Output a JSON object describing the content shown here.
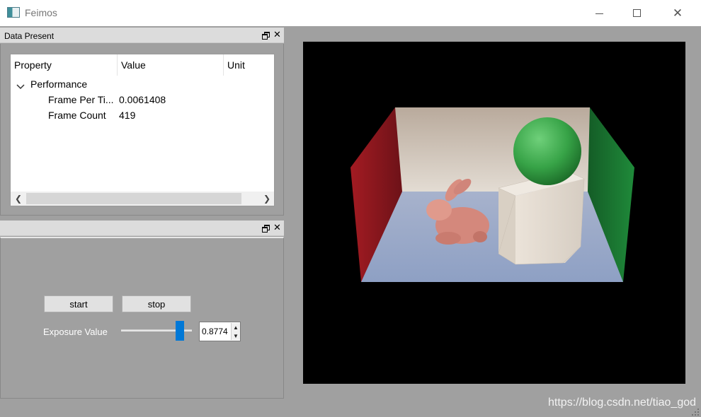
{
  "window": {
    "title": "Feimos",
    "icon": "app-window-icon"
  },
  "dock_data": {
    "title": "Data Present",
    "tree": {
      "columns": [
        "Property",
        "Value",
        "Unit"
      ],
      "group": "Performance",
      "rows": [
        {
          "property": "Frame Per Ti...",
          "value": "0.0061408",
          "unit": ""
        },
        {
          "property": "Frame Count",
          "value": "419",
          "unit": ""
        }
      ]
    }
  },
  "dock_control": {
    "title": "",
    "start_label": "start",
    "stop_label": "stop",
    "exposure_label": "Exposure Value",
    "exposure_value": "0.8774",
    "slider_level": 0.88
  },
  "watermark": "https://blog.csdn.net/tiao_god",
  "colors": {
    "slider_accent": "#0078d7",
    "viewport_bg": "#000000",
    "wall_left": "#8b1a1f",
    "wall_right": "#1f7a35",
    "sphere": "#3aa64a"
  }
}
